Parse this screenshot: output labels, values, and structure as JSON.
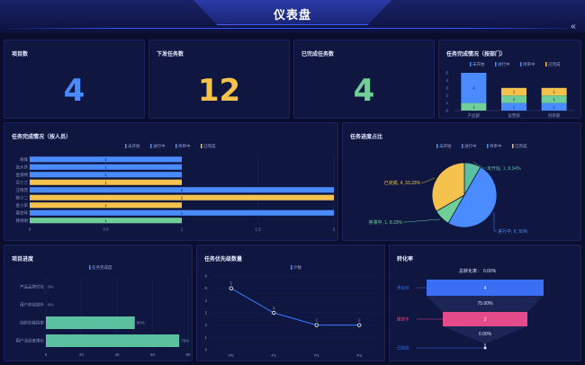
{
  "header": {
    "title": "仪表盘",
    "collapse_icon": "«"
  },
  "colors": {
    "blue": "#4a8cff",
    "yellow": "#f5c24d",
    "green": "#6fcf97",
    "teal": "#5bc0a0",
    "pink": "#e54a8a",
    "funnel_blue": "#3a6ff5",
    "line": "#3a7cff"
  },
  "stats": [
    {
      "label": "项目数",
      "value": "4",
      "color": "#4a8cff"
    },
    {
      "label": "下发任务数",
      "value": "12",
      "color": "#f5c24d"
    },
    {
      "label": "已完成任务数",
      "value": "4",
      "color": "#6fcf97"
    }
  ],
  "dept_chart": {
    "title": "任务完成情况（按部门）",
    "chart_data": {
      "type": "bar",
      "categories": [
        "产品部",
        "运营部",
        "创新部"
      ],
      "series": [
        {
          "name": "未开始",
          "values": [
            1,
            0,
            0
          ]
        },
        {
          "name": "进行中",
          "values": [
            0,
            1,
            1
          ]
        },
        {
          "name": "待审中",
          "values": [
            0,
            0,
            1
          ]
        },
        {
          "name": "已完成",
          "values": [
            4,
            0,
            1
          ]
        }
      ],
      "segment_labels": [
        [
          "1",
          "",
          "",
          "4"
        ],
        [
          "",
          "1",
          "",
          ""
        ],
        [
          "",
          "1",
          "1",
          "1"
        ]
      ],
      "stacked_display": [
        [
          1,
          4
        ],
        [
          1,
          1,
          1
        ],
        [
          1,
          1,
          1
        ]
      ],
      "yticks": [
        "0",
        "1",
        "2",
        "3",
        "4",
        "5"
      ],
      "ylim": [
        0,
        5
      ]
    }
  },
  "person_chart": {
    "title": "任务完成情况（按人员）",
    "chart_data": {
      "type": "bar",
      "orientation": "horizontal",
      "legend": [
        "未开始",
        "进行中",
        "待审中",
        "已完成"
      ],
      "categories": [
        "胡锋",
        "张大哥",
        "金雨晴",
        "吴三三",
        "汪晓苑",
        "姚小二",
        "金小梁",
        "唐莹琴",
        "韩晓明"
      ],
      "values": [
        1,
        1,
        1,
        1,
        2,
        2,
        1,
        2,
        1
      ],
      "segments": [
        [
          {
            "s": "blue",
            "v": 1
          }
        ],
        [
          {
            "s": "blue",
            "v": 1
          }
        ],
        [
          {
            "s": "blue",
            "v": 1
          }
        ],
        [
          {
            "s": "yellow",
            "v": 1
          }
        ],
        [
          {
            "s": "blue",
            "v": 2
          }
        ],
        [
          {
            "s": "yellow",
            "v": 2
          }
        ],
        [
          {
            "s": "yellow",
            "v": 1
          }
        ],
        [
          {
            "s": "blue",
            "v": 2
          }
        ],
        [
          {
            "s": "green",
            "v": 1
          }
        ]
      ],
      "bar_labels": [
        "1",
        "1",
        "1",
        "1",
        "2",
        "2",
        "1",
        "1",
        "1"
      ],
      "xticks": [
        "0",
        "0.5",
        "1",
        "1.5",
        "2"
      ],
      "xlim": [
        0,
        2
      ]
    }
  },
  "progress_pie": {
    "title": "任务进度占比",
    "chart_data": {
      "type": "pie",
      "legend": [
        "未开始",
        "进行中",
        "待审中",
        "已完成"
      ],
      "slices": [
        {
          "name": "未开始",
          "value": 1,
          "label": "未开始, 1, 8.34%",
          "color": "#5bc0a0"
        },
        {
          "name": "进行中",
          "value": 6,
          "label": "进行中, 6, 50%",
          "color": "#4a8cff"
        },
        {
          "name": "待审中",
          "value": 1,
          "label": "停滞中, 1, 8.33%",
          "color": "#6fcf97"
        },
        {
          "name": "已完成",
          "value": 4,
          "label": "已完成, 4, 33.33%",
          "color": "#f5c24d"
        }
      ]
    }
  },
  "project_progress": {
    "title": "项目进度",
    "chart_data": {
      "type": "bar",
      "orientation": "horizontal",
      "legend": [
        "任务完成度"
      ],
      "categories": [
        "产品品牌优化",
        "用户体验提升",
        "创新功能探索",
        "用户活跃度增长"
      ],
      "values": [
        0,
        0,
        50,
        75
      ],
      "bar_labels": [
        "0%",
        "0%",
        "50%",
        "75%"
      ],
      "xticks": [
        "0",
        "20",
        "40",
        "60",
        "80"
      ],
      "xlim": [
        0,
        80
      ]
    }
  },
  "priority_chart": {
    "title": "任务优先级数量",
    "chart_data": {
      "type": "line",
      "legend": [
        "计数"
      ],
      "categories": [
        "P0",
        "P1",
        "P2",
        "P3"
      ],
      "values": [
        5,
        3,
        2,
        2
      ],
      "yticks": [
        "0",
        "1",
        "2",
        "3",
        "4",
        "5",
        "6"
      ],
      "ylim": [
        0,
        6
      ]
    }
  },
  "conversion": {
    "title": "转化率",
    "total_label": "总转化率：",
    "total_value": "0.00%",
    "chart_data": {
      "type": "funnel",
      "stages": [
        {
          "name": "未启动",
          "value": "4",
          "color": "#3a6ff5"
        },
        {
          "name": "推进中",
          "value": "3",
          "color": "#e54a8a"
        },
        {
          "name": "已完成",
          "value": "0",
          "color": "#3a6ff5"
        }
      ],
      "rates": [
        "75.00%",
        "0.00%"
      ]
    }
  }
}
